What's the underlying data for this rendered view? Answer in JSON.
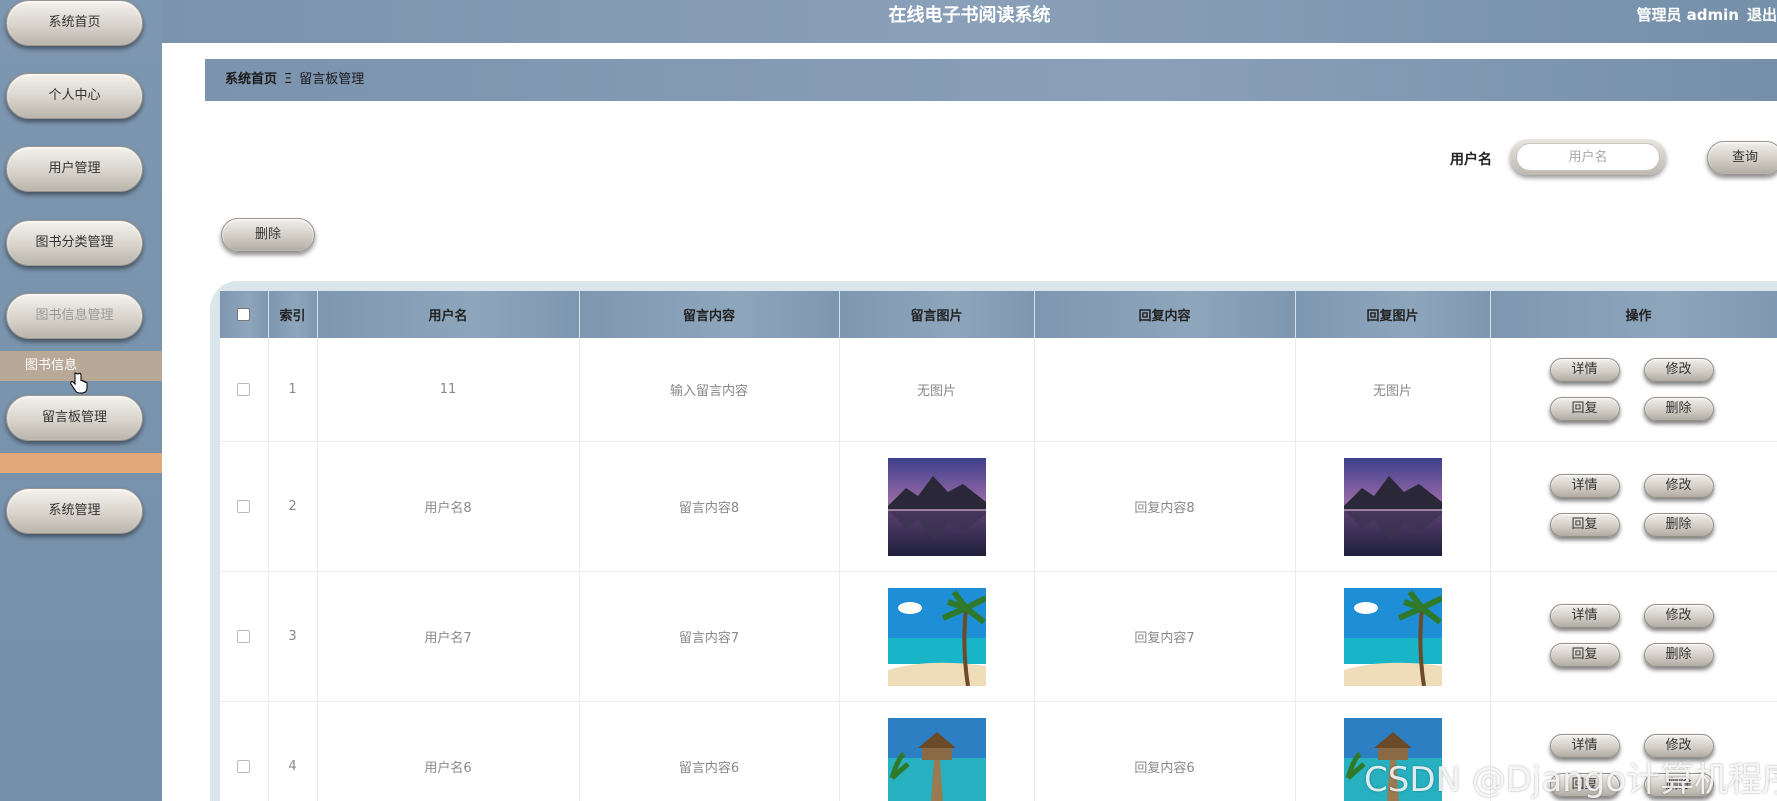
{
  "app": {
    "title": "在线电子书阅读系统",
    "admin_label": "管理员 admin",
    "logout_label": "退出"
  },
  "sidebar": {
    "items": [
      {
        "label": "系统首页"
      },
      {
        "label": "个人中心"
      },
      {
        "label": "用户管理"
      },
      {
        "label": "图书分类管理"
      },
      {
        "label": "图书信息管理"
      },
      {
        "label": "留言板管理"
      },
      {
        "label": "系统管理"
      }
    ],
    "submenu_hover_label": "图书信息"
  },
  "breadcrumb": {
    "home": "系统首页",
    "separator": "Ξ",
    "current": "留言板管理"
  },
  "search": {
    "label": "用户名",
    "placeholder": "用户名",
    "button_label": "查询"
  },
  "actions": {
    "delete_label": "删除"
  },
  "table": {
    "columns": [
      "索引",
      "用户名",
      "留言内容",
      "留言图片",
      "回复内容",
      "回复图片",
      "操作"
    ],
    "rows": [
      {
        "index": "1",
        "username": "11",
        "content": "输入留言内容",
        "image": "无图片",
        "reply": "",
        "reply_image": "无图片"
      },
      {
        "index": "2",
        "username": "用户名8",
        "content": "留言内容8",
        "image": "mountain-lake",
        "reply": "回复内容8",
        "reply_image": "mountain-lake"
      },
      {
        "index": "3",
        "username": "用户名7",
        "content": "留言内容7",
        "image": "tropical-beach",
        "reply": "回复内容7",
        "reply_image": "tropical-beach"
      },
      {
        "index": "4",
        "username": "用户名6",
        "content": "留言内容6",
        "image": "overwater-hut",
        "reply": "回复内容6",
        "reply_image": "overwater-hut"
      }
    ],
    "row_actions": {
      "detail": "详情",
      "edit": "修改",
      "reply": "回复",
      "delete": "删除"
    }
  },
  "watermark": "CSDN @Django计算机程序",
  "colors": {
    "header": "#7b93ad",
    "sidebar": "#7e97b0",
    "hover": "#b8a898",
    "orange": "#e2a878"
  }
}
